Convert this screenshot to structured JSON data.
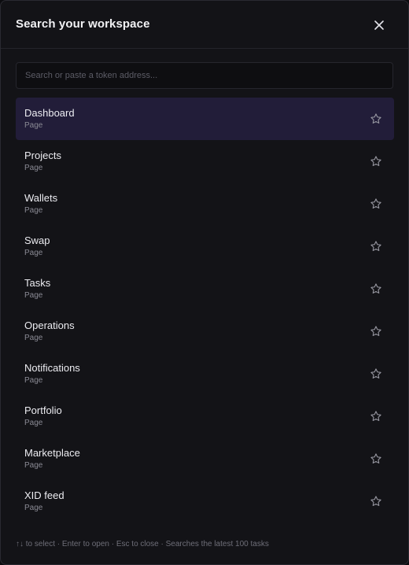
{
  "header": {
    "title": "Search your workspace",
    "close_icon": "close-icon"
  },
  "search": {
    "value": "",
    "placeholder": "Search or paste a token address..."
  },
  "results": [
    {
      "name": "Dashboard",
      "type": "Page",
      "active": true,
      "starred": false
    },
    {
      "name": "Projects",
      "type": "Page",
      "active": false,
      "starred": false
    },
    {
      "name": "Wallets",
      "type": "Page",
      "active": false,
      "starred": false
    },
    {
      "name": "Swap",
      "type": "Page",
      "active": false,
      "starred": false
    },
    {
      "name": "Tasks",
      "type": "Page",
      "active": false,
      "starred": false
    },
    {
      "name": "Operations",
      "type": "Page",
      "active": false,
      "starred": false
    },
    {
      "name": "Notifications",
      "type": "Page",
      "active": false,
      "starred": false
    },
    {
      "name": "Portfolio",
      "type": "Page",
      "active": false,
      "starred": false
    },
    {
      "name": "Marketplace",
      "type": "Page",
      "active": false,
      "starred": false
    },
    {
      "name": "XID feed",
      "type": "Page",
      "active": false,
      "starred": false
    }
  ],
  "footer": {
    "hint": "↑↓ to select · Enter to open · Esc to close · Searches the latest 100 tasks"
  },
  "colors": {
    "background": "#131317",
    "active_row": "#221d39",
    "text": "#ececf1",
    "muted": "#8a8a94"
  }
}
